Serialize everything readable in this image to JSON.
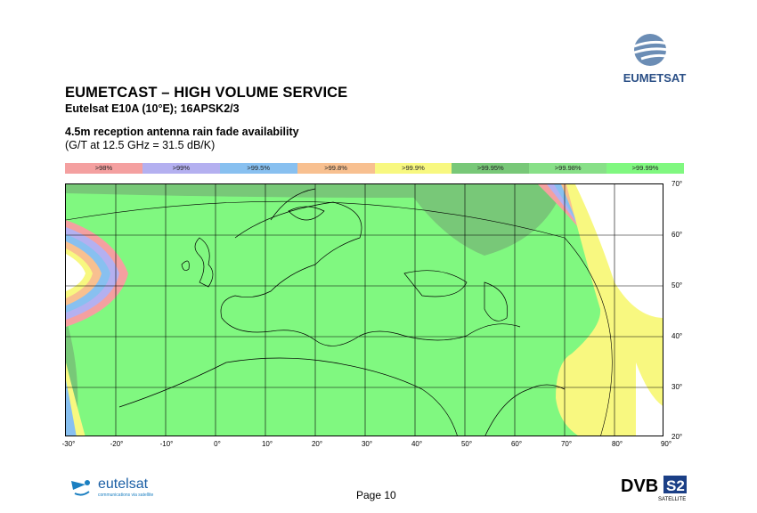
{
  "header": {
    "title": "EUMETCAST – HIGH VOLUME SERVICE",
    "subtitle": "Eutelsat E10A (10°E); 16APSK2/3",
    "description": "4.5m reception antenna rain fade availability",
    "description_note": "(G/T at 12.5 GHz = 31.5 dB/K)"
  },
  "brand": {
    "eumetsat_wordmark": "EUMETSAT",
    "eutelsat_wordmark": "eutelsat",
    "eutelsat_tagline": "communications via satellite",
    "dvb_wordmark": "DVB",
    "dvb_s2": "S2",
    "dvb_satellite": "SATELLITE"
  },
  "legend": [
    {
      "label": ">98%",
      "color": "#f4a0a0"
    },
    {
      "label": ">99%",
      "color": "#b4b0f0"
    },
    {
      "label": ">99.5%",
      "color": "#88c0f0"
    },
    {
      "label": ">99.8%",
      "color": "#f8c090"
    },
    {
      "label": ">99.9%",
      "color": "#f8f880"
    },
    {
      "label": ">99.95%",
      "color": "#78c878"
    },
    {
      "label": ">99.98%",
      "color": "#88e088"
    },
    {
      "label": ">99.99%",
      "color": "#80f880"
    }
  ],
  "map": {
    "lon_labels": [
      "-30°",
      "-20°",
      "-10°",
      "0°",
      "10°",
      "20°",
      "30°",
      "40°",
      "50°",
      "60°",
      "70°",
      "80°",
      "90°"
    ],
    "lat_labels": [
      "70°",
      "60°",
      "50°",
      "40°",
      "30°",
      "20°"
    ]
  },
  "footer": {
    "page": "Page 10"
  }
}
